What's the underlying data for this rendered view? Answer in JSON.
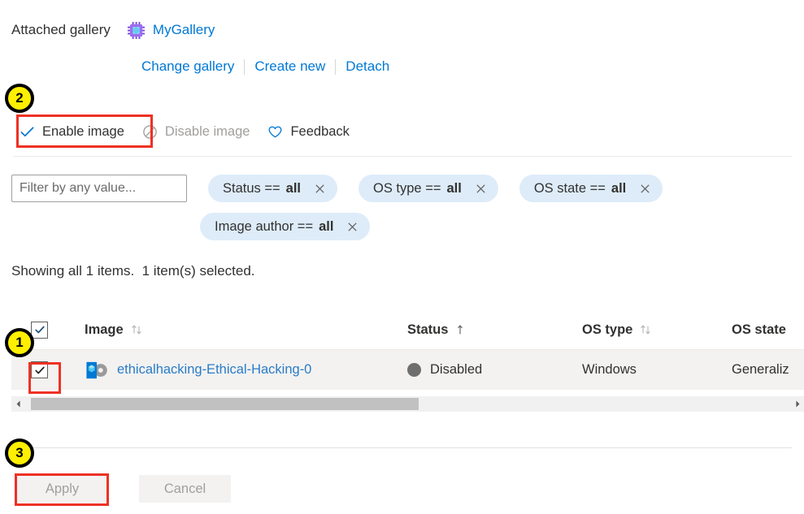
{
  "gallery": {
    "label": "Attached gallery",
    "icon": "compute-gallery-icon",
    "name": "MyGallery",
    "actions": [
      {
        "label": "Change gallery"
      },
      {
        "label": "Create new"
      },
      {
        "label": "Detach"
      }
    ]
  },
  "commandbar": {
    "items": [
      {
        "label": "Enable image",
        "icon": "checkmark-icon",
        "disabled": false
      },
      {
        "label": "Disable image",
        "icon": "block-icon",
        "disabled": true
      },
      {
        "label": "Feedback",
        "icon": "heart-icon",
        "disabled": false
      }
    ]
  },
  "filters": {
    "search_placeholder": "Filter by any value...",
    "search_value": "",
    "pills": [
      {
        "field": "Status ==",
        "value": "all",
        "remove_icon": "close-icon"
      },
      {
        "field": "OS type ==",
        "value": "all",
        "remove_icon": "close-icon"
      },
      {
        "field": "OS state ==",
        "value": "all",
        "remove_icon": "close-icon"
      },
      {
        "field": "Image author ==",
        "value": "all",
        "remove_icon": "close-icon"
      }
    ]
  },
  "status_line": "Showing all 1 items.  1 item(s) selected.",
  "table": {
    "select_all_checked": true,
    "columns": [
      {
        "label": "Image",
        "sort_icon": "sort-both-icon"
      },
      {
        "label": "Status",
        "sort_icon": "sort-asc-icon"
      },
      {
        "label": "OS type",
        "sort_icon": "sort-both-icon"
      },
      {
        "label": "OS state",
        "sort_icon": ""
      }
    ],
    "rows": [
      {
        "checked": true,
        "image_icon": "vm-image-icon",
        "image": "ethicalhacking-Ethical-Hacking-0",
        "status": "Disabled",
        "status_dot_color": "#6e6e6e",
        "os_type": "Windows",
        "os_state": "Generaliz"
      }
    ]
  },
  "scrollbar": {
    "left_arrow": "chevron-left-icon",
    "right_arrow": "chevron-right-icon"
  },
  "footer": {
    "apply_label": "Apply",
    "cancel_label": "Cancel"
  },
  "annotations": {
    "markers": [
      {
        "number": "1"
      },
      {
        "number": "2"
      },
      {
        "number": "3"
      }
    ],
    "highlight_color": "#ee3124",
    "marker_fill": "#ffef00"
  }
}
